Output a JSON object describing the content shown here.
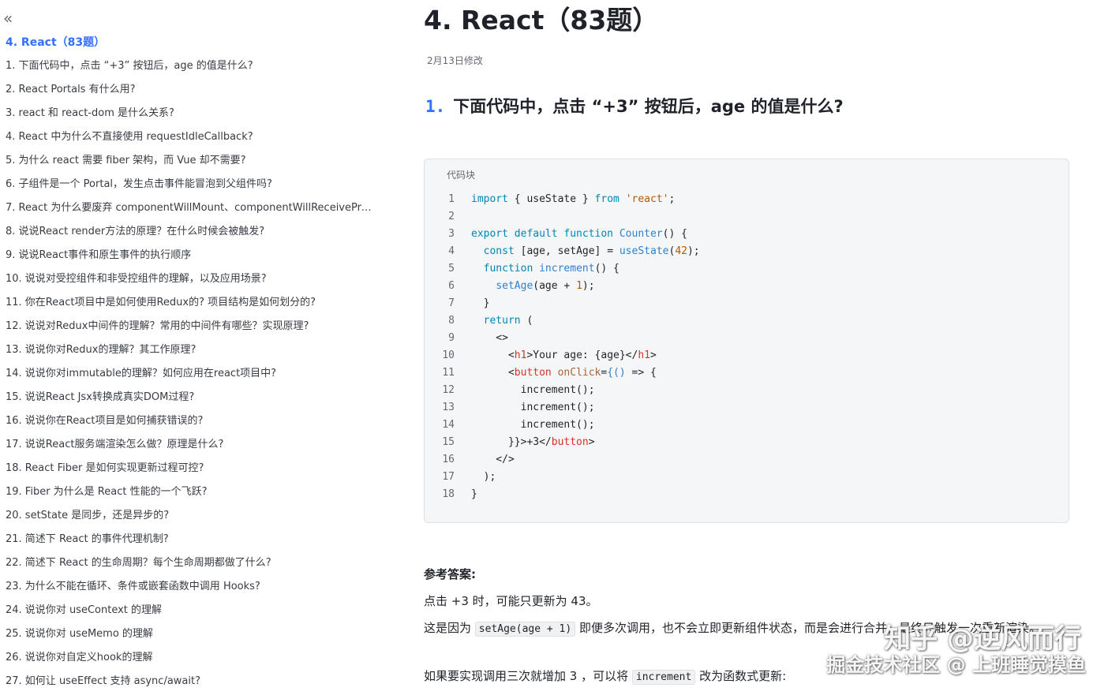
{
  "sidebar": {
    "collapse_icon": "«",
    "title": "4. React（83题）",
    "items": [
      "1. 下面代码中，点击 “+3” 按钮后，age 的值是什么?",
      "2. React Portals 有什么用?",
      "3. react 和 react-dom 是什么关系?",
      "4. React 中为什么不直接使用 requestIdleCallback?",
      "5. 为什么 react 需要 fiber 架构，而 Vue 却不需要?",
      "6. 子组件是一个 Portal，发生点击事件能冒泡到父组件吗?",
      "7. React 为什么要废弃 componentWillMount、componentWillReceiveProp...",
      "8. 说说React render方法的原理？在什么时候会被触发?",
      "9. 说说React事件和原生事件的执行顺序",
      "10. 说说对受控组件和非受控组件的理解，以及应用场景?",
      "11. 你在React项目中是如何使用Redux的? 项目结构是如何划分的?",
      "12. 说说对Redux中间件的理解？常用的中间件有哪些？实现原理?",
      "13. 说说你对Redux的理解？其工作原理?",
      "14. 说说你对immutable的理解？如何应用在react项目中?",
      "15. 说说React Jsx转换成真实DOM过程?",
      "16. 说说你在React项目是如何捕获错误的?",
      "17. 说说React服务端渲染怎么做？原理是什么?",
      "18. React Fiber 是如何实现更新过程可控?",
      "19. Fiber 为什么是 React 性能的一个飞跃?",
      "20. setState 是同步，还是异步的?",
      "21. 简述下 React 的事件代理机制?",
      "22. 简述下 React 的生命周期？每个生命周期都做了什么?",
      "23. 为什么不能在循环、条件或嵌套函数中调用 Hooks?",
      "24. 说说你对 useContext 的理解",
      "25. 说说你对 useMemo 的理解",
      "26. 说说你对自定义hook的理解",
      "27. 如何让 useEffect 支持 async/await?"
    ]
  },
  "main": {
    "title": "4. React（83题）",
    "modified": "2月13日修改",
    "question_number": "1.",
    "question_text": "下面代码中，点击 “+3” 按钮后，age 的值是什么?",
    "code_label": "代码块",
    "code_lines": [
      {
        "n": "1",
        "tokens": [
          [
            "kw",
            "import"
          ],
          [
            "plain",
            " { useState } "
          ],
          [
            "kw",
            "from"
          ],
          [
            "plain",
            " "
          ],
          [
            "str",
            "'react'"
          ],
          [
            "plain",
            ";"
          ]
        ]
      },
      {
        "n": "2",
        "tokens": []
      },
      {
        "n": "3",
        "tokens": [
          [
            "kw",
            "export default function"
          ],
          [
            "plain",
            " "
          ],
          [
            "fn",
            "Counter"
          ],
          [
            "plain",
            "() {"
          ]
        ]
      },
      {
        "n": "4",
        "tokens": [
          [
            "plain",
            "  "
          ],
          [
            "kw",
            "const"
          ],
          [
            "plain",
            " [age, setAge] = "
          ],
          [
            "fn",
            "useState"
          ],
          [
            "plain",
            "("
          ],
          [
            "nm",
            "42"
          ],
          [
            "plain",
            ");"
          ]
        ]
      },
      {
        "n": "5",
        "tokens": [
          [
            "plain",
            "  "
          ],
          [
            "kw",
            "function"
          ],
          [
            "plain",
            " "
          ],
          [
            "fn",
            "increment"
          ],
          [
            "plain",
            "() {"
          ]
        ]
      },
      {
        "n": "6",
        "tokens": [
          [
            "plain",
            "    "
          ],
          [
            "fn",
            "setAge"
          ],
          [
            "plain",
            "(age + "
          ],
          [
            "nm",
            "1"
          ],
          [
            "plain",
            ");"
          ]
        ]
      },
      {
        "n": "7",
        "tokens": [
          [
            "plain",
            "  }"
          ]
        ]
      },
      {
        "n": "8",
        "tokens": [
          [
            "plain",
            "  "
          ],
          [
            "kw",
            "return"
          ],
          [
            "plain",
            " ("
          ]
        ]
      },
      {
        "n": "9",
        "tokens": [
          [
            "plain",
            "    <>"
          ]
        ]
      },
      {
        "n": "10",
        "tokens": [
          [
            "plain",
            "      <"
          ],
          [
            "tag",
            "h1"
          ],
          [
            "plain",
            ">Your age: {age}</"
          ],
          [
            "tag",
            "h1"
          ],
          [
            "plain",
            ">"
          ]
        ]
      },
      {
        "n": "11",
        "tokens": [
          [
            "plain",
            "      <"
          ],
          [
            "tag",
            "button"
          ],
          [
            "plain",
            " "
          ],
          [
            "attr",
            "onClick"
          ],
          [
            "plain",
            "="
          ],
          [
            "fn",
            "{()"
          ],
          [
            "plain",
            " => {"
          ]
        ]
      },
      {
        "n": "12",
        "tokens": [
          [
            "plain",
            "        increment();"
          ]
        ]
      },
      {
        "n": "13",
        "tokens": [
          [
            "plain",
            "        increment();"
          ]
        ]
      },
      {
        "n": "14",
        "tokens": [
          [
            "plain",
            "        increment();"
          ]
        ]
      },
      {
        "n": "15",
        "tokens": [
          [
            "plain",
            "      }}>+3</"
          ],
          [
            "tag",
            "button"
          ],
          [
            "plain",
            ">"
          ]
        ]
      },
      {
        "n": "16",
        "tokens": [
          [
            "plain",
            "    </>"
          ]
        ]
      },
      {
        "n": "17",
        "tokens": [
          [
            "plain",
            "  );"
          ]
        ]
      },
      {
        "n": "18",
        "tokens": [
          [
            "plain",
            "}"
          ]
        ]
      }
    ],
    "answer_title": "参考答案:",
    "answer_p1": "点击 +3 时，可能只更新为 43。",
    "answer_p2_a": "这是因为",
    "answer_p2_code": "setAge(age + 1)",
    "answer_p2_b": "即便多次调用，也不会立即更新组件状态，而是会进行合并，最终只触发一次重新渲染。",
    "answer_p3_a": "如果要实现调用三次就增加 3 ，可以将",
    "answer_p3_code": "increment",
    "answer_p3_b": "改为函数式更新:"
  },
  "watermark": {
    "line1": "知乎 @逆风而行",
    "line2": "掘金技术社区 @ 上班睡觉摸鱼"
  },
  "colors": {
    "accent": "#3370ff",
    "code_bg": "#f5f6f7",
    "keyword": "#0086b3",
    "string": "#b35900",
    "tag": "#d93026"
  }
}
